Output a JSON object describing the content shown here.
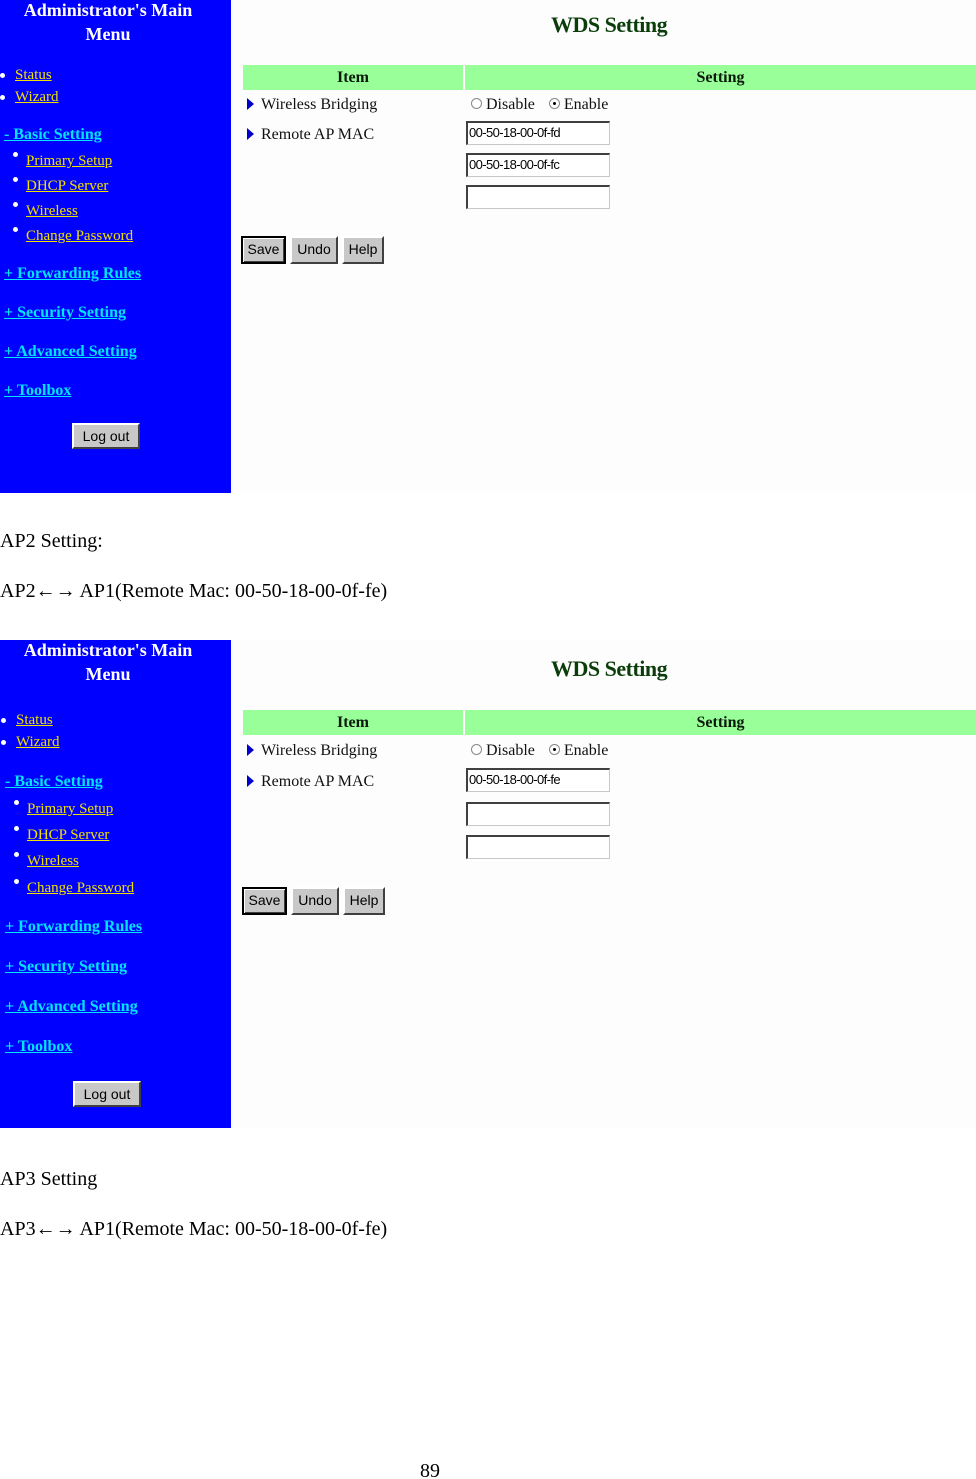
{
  "screenshots": [
    {
      "sidebar": {
        "title_line1": "Administrator's Main",
        "title_line2": "Menu",
        "top_links": [
          "Status",
          "Wizard"
        ],
        "basic_setting": "- Basic Setting",
        "sub_links": [
          "Primary Setup",
          "DHCP Server",
          "Wireless",
          "Change Password"
        ],
        "sections": [
          "+ Forwarding Rules",
          "+ Security Setting",
          "+ Advanced Setting",
          "+ Toolbox"
        ],
        "logout_label": "Log out"
      },
      "main": {
        "title": "WDS Setting",
        "col_item": "Item",
        "col_setting": "Setting",
        "row_bridging": "Wireless Bridging",
        "row_remote_mac": "Remote AP MAC",
        "radio_disable": "Disable",
        "radio_enable": "Enable",
        "selected": "Enable",
        "mac_values": [
          "00-50-18-00-0f-fd",
          "00-50-18-00-0f-fc",
          ""
        ],
        "save_label": "Save",
        "undo_label": "Undo",
        "help_label": "Help"
      }
    },
    {
      "sidebar": {
        "title_line1": "Administrator's Main",
        "title_line2": "Menu",
        "top_links": [
          "Status",
          "Wizard"
        ],
        "basic_setting": "- Basic Setting",
        "sub_links": [
          "Primary Setup",
          "DHCP Server",
          "Wireless",
          "Change Password"
        ],
        "sections": [
          "+ Forwarding Rules",
          "+ Security Setting",
          "+ Advanced Setting",
          "+ Toolbox"
        ],
        "logout_label": "Log out"
      },
      "main": {
        "title": "WDS Setting",
        "col_item": "Item",
        "col_setting": "Setting",
        "row_bridging": "Wireless Bridging",
        "row_remote_mac": "Remote AP MAC",
        "radio_disable": "Disable",
        "radio_enable": "Enable",
        "selected": "Enable",
        "mac_values": [
          "00-50-18-00-0f-fe",
          "",
          ""
        ],
        "save_label": "Save",
        "undo_label": "Undo",
        "help_label": "Help"
      }
    }
  ],
  "document": {
    "ap2_heading": "AP2 Setting:",
    "ap2_link": "AP2←→ AP1(Remote Mac: 00-50-18-00-0f-fe)",
    "ap3_heading": "AP3 Setting",
    "ap3_link": "AP3←→ AP1(Remote Mac: 00-50-18-00-0f-fe)",
    "page_number": "89"
  },
  "colors": {
    "sidebar_bg": "#0000fe",
    "link_yellow": "#f0e000",
    "link_cyan": "#00e5ff",
    "table_header": "#99ff99",
    "title_green": "#0a3d0a"
  }
}
